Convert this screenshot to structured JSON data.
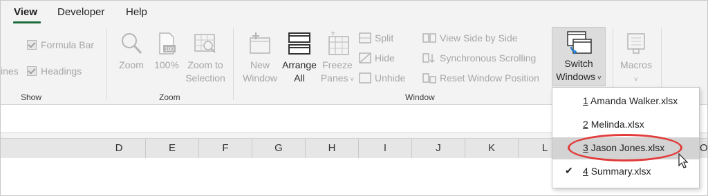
{
  "tabs": [
    {
      "label": "View"
    },
    {
      "label": "Developer"
    },
    {
      "label": "Help"
    }
  ],
  "show_group": {
    "cut_label": "ines",
    "formula_bar": "Formula Bar",
    "headings": "Headings",
    "label": "Show"
  },
  "zoom_group": {
    "zoom": "Zoom",
    "hundred": "100%",
    "zoom_to_selection_1": "Zoom to",
    "zoom_to_selection_2": "Selection",
    "label": "Zoom",
    "icon_text": "100"
  },
  "window_group": {
    "new_window_1": "New",
    "new_window_2": "Window",
    "arrange_1": "Arrange",
    "arrange_2": "All",
    "freeze_1": "Freeze",
    "freeze_2": "Panes",
    "split": "Split",
    "hide": "Hide",
    "unhide": "Unhide",
    "side_by_side": "View Side by Side",
    "sync_scroll": "Synchronous Scrolling",
    "reset_pos": "Reset Window Position",
    "switch_1": "Switch",
    "switch_2": "Windows",
    "label": "Window"
  },
  "macros_group": {
    "macros": "Macros"
  },
  "columns": [
    "D",
    "E",
    "F",
    "G",
    "H",
    "I",
    "J",
    "K",
    "L",
    "O"
  ],
  "switch_menu": {
    "items": [
      {
        "num": "1",
        "name": "Amanda Walker.xlsx",
        "checked": false,
        "highlighted": false
      },
      {
        "num": "2",
        "name": "Melinda.xlsx",
        "checked": false,
        "highlighted": false
      },
      {
        "num": "3",
        "name": "Jason Jones.xlsx",
        "checked": false,
        "highlighted": true
      },
      {
        "num": "4",
        "name": "Summary.xlsx",
        "checked": true,
        "highlighted": false
      }
    ],
    "check_glyph": "✔"
  },
  "colors": {
    "accent_green": "#1e6c3a",
    "highlight_circle": "#e23b3b",
    "disabled_text": "#a6a6a6"
  }
}
